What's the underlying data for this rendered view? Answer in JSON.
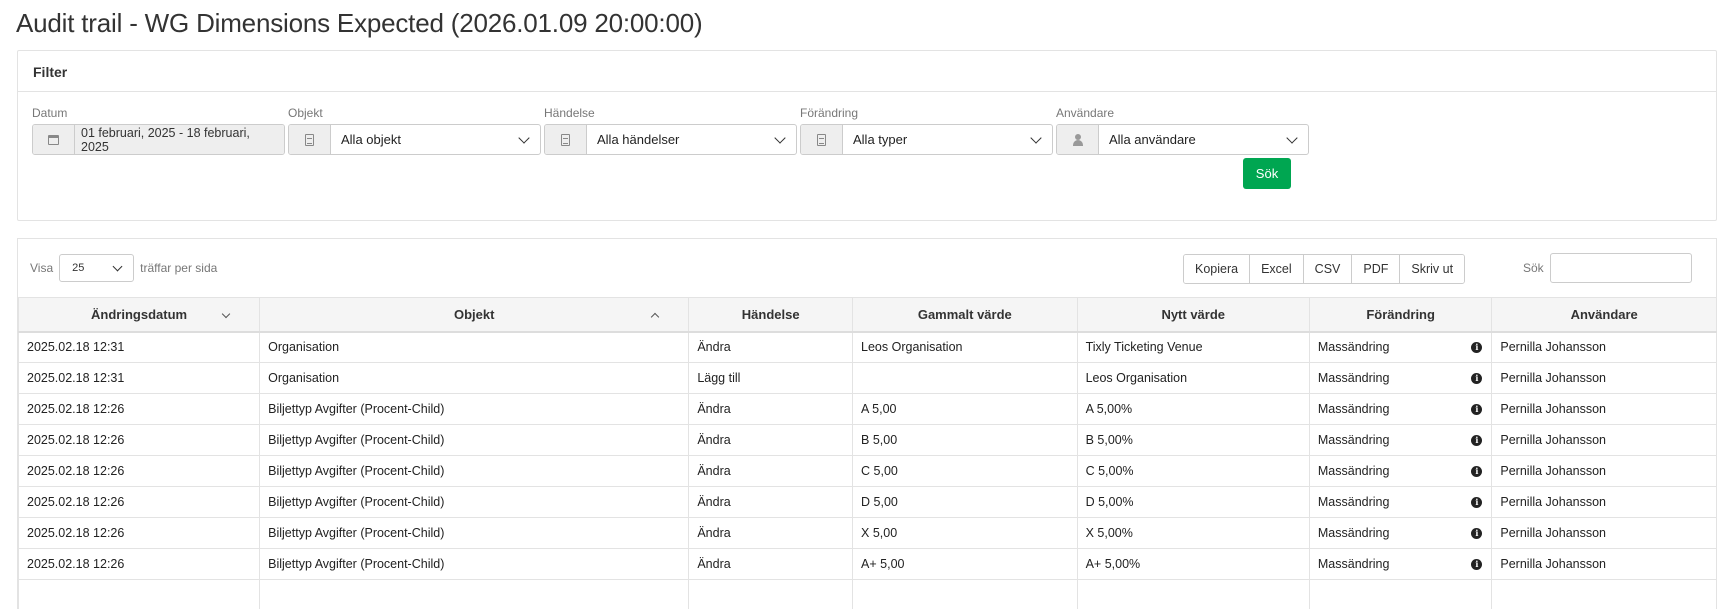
{
  "page": {
    "title": "Audit trail - WG Dimensions Expected (2026.01.09 20:00:00)"
  },
  "filter": {
    "heading": "Filter",
    "datum": {
      "label": "Datum",
      "value": "01 februari, 2025 - 18 februari, 2025",
      "icon": "calendar-icon"
    },
    "objekt": {
      "label": "Objekt",
      "value": "Alla objekt",
      "icon": "list-icon"
    },
    "handelse": {
      "label": "Händelse",
      "value": "Alla händelser",
      "icon": "list-icon"
    },
    "forandring": {
      "label": "Förändring",
      "value": "Alla typer",
      "icon": "list-icon"
    },
    "anvandare": {
      "label": "Användare",
      "value": "Alla användare",
      "icon": "user-icon"
    },
    "search_button": "Sök",
    "accent_color": "#00a651"
  },
  "table_controls": {
    "show_label": "Visa",
    "page_size": "25",
    "per_page_label": "träffar per sida",
    "export_buttons": [
      "Kopiera",
      "Excel",
      "CSV",
      "PDF",
      "Skriv ut"
    ],
    "search_label": "Sök",
    "search_value": ""
  },
  "table": {
    "columns": [
      "Ändringsdatum",
      "Objekt",
      "Händelse",
      "Gammalt värde",
      "Nytt värde",
      "Förändring",
      "Användare"
    ],
    "rows": [
      [
        "2025.02.18 12:31",
        "Organisation",
        "Ändra",
        "Leos Organisation",
        "Tixly Ticketing Venue",
        "Massändring",
        "Pernilla Johansson"
      ],
      [
        "2025.02.18 12:31",
        "Organisation",
        "Lägg till",
        "",
        "Leos Organisation",
        "Massändring",
        "Pernilla Johansson"
      ],
      [
        "2025.02.18 12:26",
        "Biljettyp Avgifter (Procent-Child)",
        "Ändra",
        "A 5,00",
        "A 5,00%",
        "Massändring",
        "Pernilla Johansson"
      ],
      [
        "2025.02.18 12:26",
        "Biljettyp Avgifter (Procent-Child)",
        "Ändra",
        "B 5,00",
        "B 5,00%",
        "Massändring",
        "Pernilla Johansson"
      ],
      [
        "2025.02.18 12:26",
        "Biljettyp Avgifter (Procent-Child)",
        "Ändra",
        "C 5,00",
        "C 5,00%",
        "Massändring",
        "Pernilla Johansson"
      ],
      [
        "2025.02.18 12:26",
        "Biljettyp Avgifter (Procent-Child)",
        "Ändra",
        "D 5,00",
        "D 5,00%",
        "Massändring",
        "Pernilla Johansson"
      ],
      [
        "2025.02.18 12:26",
        "Biljettyp Avgifter (Procent-Child)",
        "Ändra",
        "X 5,00",
        "X 5,00%",
        "Massändring",
        "Pernilla Johansson"
      ],
      [
        "2025.02.18 12:26",
        "Biljettyp Avgifter (Procent-Child)",
        "Ändra",
        "A+ 5,00",
        "A+ 5,00%",
        "Massändring",
        "Pernilla Johansson"
      ],
      [
        "",
        "",
        "",
        "",
        "",
        "",
        ""
      ]
    ]
  }
}
